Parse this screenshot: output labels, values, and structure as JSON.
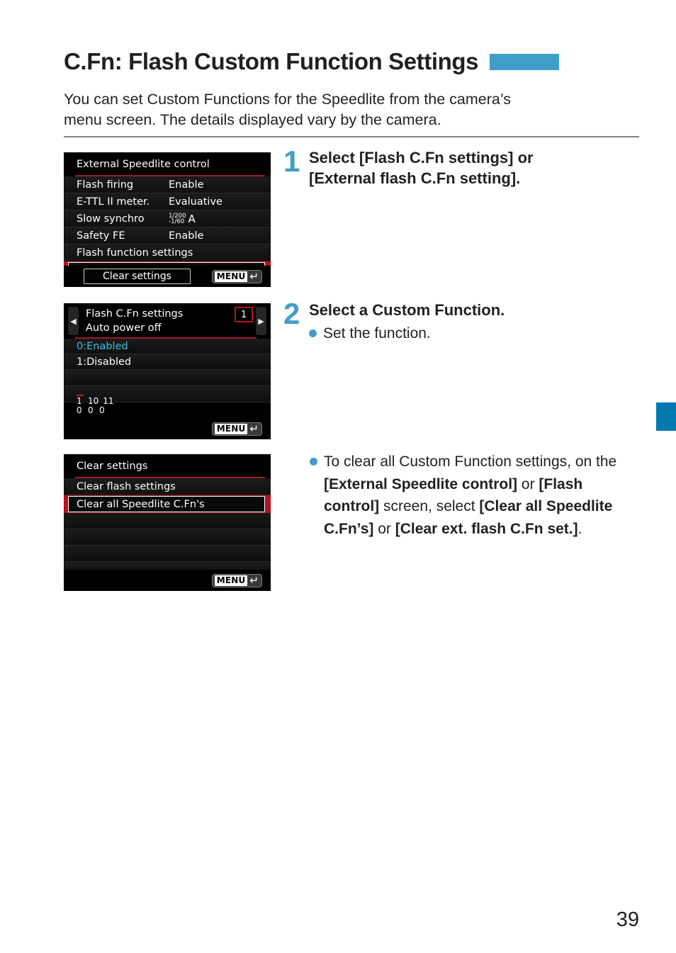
{
  "page": {
    "title": "C.Fn: Flash Custom Function Settings",
    "intro_line_1": "You can set Custom Functions for the Speedlite from the camera’s",
    "intro_line_2": "menu screen. The details displayed vary by the camera.",
    "folio": "39",
    "accent_color": "#3f9ec9",
    "tab_color": "#0479b0"
  },
  "screens": {
    "screen1": {
      "title": "External Speedlite control",
      "rows": [
        {
          "label": "Flash firing",
          "value": "Enable"
        },
        {
          "label": "E-TTL II meter.",
          "value": "Evaluative"
        },
        {
          "label": "Slow synchro",
          "value": "1/200 -1/60 A"
        },
        {
          "label": "Safety FE",
          "value": "Enable"
        },
        {
          "label": "Flash function settings",
          "value": ""
        }
      ],
      "slow_synchro": {
        "numerator": "1/200",
        "denominator": "-1/60",
        "mode": "A"
      },
      "selected_row": "Flash C.Fn settings",
      "clear_button": "Clear settings",
      "menu_button": "MENU"
    },
    "screen2": {
      "title": "Flash C.Fn settings",
      "subtitle": "Auto power off",
      "number_badge": "1",
      "prev_arrow": "◀",
      "next_arrow": "▶",
      "options": [
        {
          "label": "0:Enabled",
          "selected": true
        },
        {
          "label": "1:Disabled",
          "selected": false
        }
      ],
      "status_numbers_top": [
        "1",
        "10",
        "11"
      ],
      "status_numbers_bottom": [
        "0",
        "0",
        "0"
      ],
      "menu_button": "MENU"
    },
    "screen3": {
      "title": "Clear settings",
      "rows": [
        {
          "label": "Clear flash settings",
          "selected": false
        },
        {
          "label": "Clear all Speedlite C.Fn's",
          "selected": true
        }
      ],
      "menu_button": "MENU"
    }
  },
  "steps": [
    {
      "number": "1",
      "heading_line_1": "Select [Flash C.Fn settings] or",
      "heading_line_2": "[External flash C.Fn setting]."
    },
    {
      "number": "2",
      "heading_line_1": "Select a Custom Function.",
      "bullet": "Set the function."
    }
  ],
  "note": {
    "p1": "To clear all Custom Function settings, on the ",
    "b1": "[External Speedlite control]",
    "p2": " or ",
    "b2": "[Flash control]",
    "p3": " screen, select ",
    "b3": "[Clear all Speedlite C.Fn’s]",
    "p4": " or ",
    "b4": "[Clear ext. flash C.Fn set.]",
    "p5": "."
  }
}
